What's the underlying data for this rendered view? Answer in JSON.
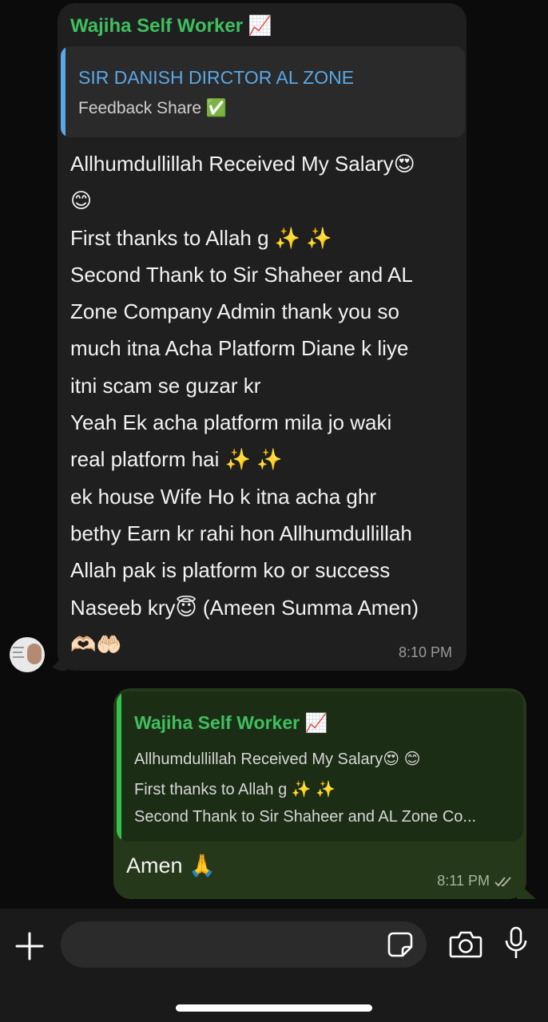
{
  "incoming": {
    "sender": "Wajiha Self Worker 📈",
    "quote_title": "SIR DANISH DIRCTOR AL ZONE",
    "quote_text": "Feedback Share ✅",
    "body": "Allhumdullillah Received My Salary😍\n😊\nFirst thanks to Allah g ✨ ✨\nSecond Thank to Sir Shaheer and AL\nZone Company Admin thank you so\nmuch itna Acha Platform Diane k liye\nitni scam se guzar kr\nYeah Ek acha platform mila jo waki\nreal platform hai ✨ ✨\nek house Wife Ho k itna acha ghr\nbethy Earn kr rahi hon Allhumdullillah\nAllah pak is platform ko or success\nNaseeb kry😇 (Ameen Summa Amen)\n🫶🏻🤲🏻",
    "time": "8:10 PM"
  },
  "outgoing": {
    "quote_sender": "Wajiha Self Worker 📈",
    "quote_lines": [
      "Allhumdullillah Received My Salary😍 😊",
      "First thanks to Allah g ✨ ✨",
      "Second Thank to Sir Shaheer and AL Zone Co..."
    ],
    "text": "Amen 🙏",
    "time": "8:11 PM"
  },
  "input": {
    "placeholder": "",
    "value": ""
  },
  "icons": {
    "plus": "plus-icon",
    "sticker": "sticker-icon",
    "camera": "camera-icon",
    "mic": "microphone-icon"
  },
  "colors": {
    "sender_green": "#3fbf5f",
    "quote_blue": "#5aa8e6",
    "outgoing_bubble": "#25381a"
  }
}
